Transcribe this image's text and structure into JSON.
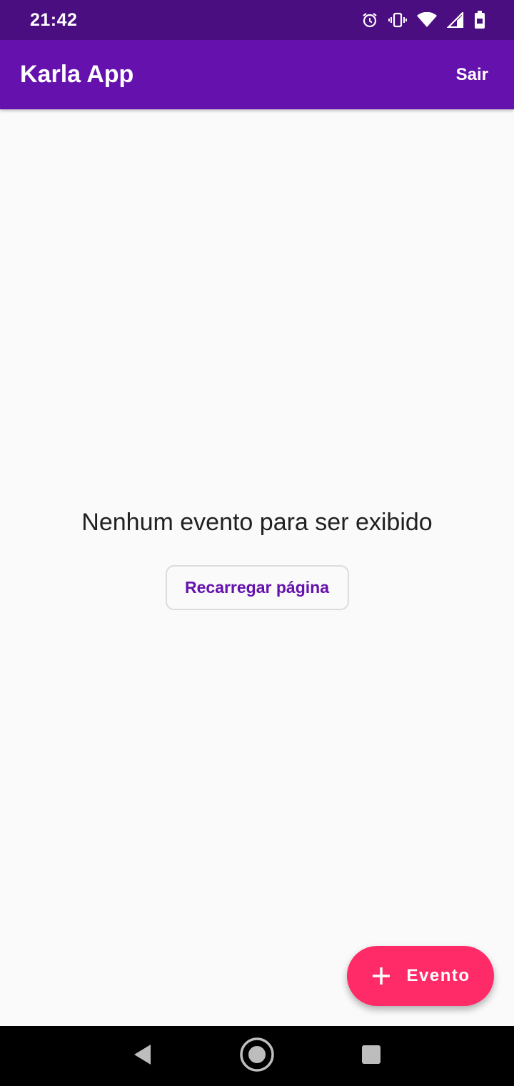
{
  "status_bar": {
    "time": "21:42",
    "icons": [
      "alarm-icon",
      "vibrate-icon",
      "wifi-icon",
      "signal-icon",
      "battery-icon"
    ]
  },
  "app_bar": {
    "title": "Karla App",
    "action_label": "Sair"
  },
  "main": {
    "empty_message": "Nenhum evento para ser exibido",
    "reload_label": "Recarregar página"
  },
  "fab": {
    "icon": "plus-icon",
    "label": "Evento"
  },
  "nav_bar": {
    "buttons": [
      "back-icon",
      "home-icon",
      "recents-icon"
    ]
  },
  "colors": {
    "status_bar": "#4a0e80",
    "app_bar": "#6511ae",
    "accent": "#fe2b68",
    "background": "#fafafa"
  }
}
